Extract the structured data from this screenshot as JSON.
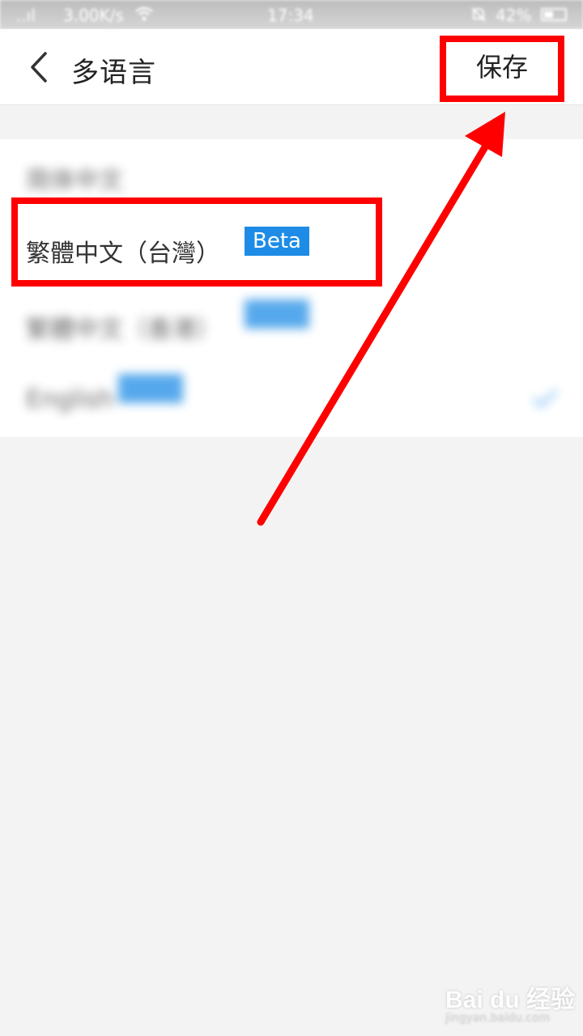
{
  "status_bar": {
    "signal": "..ıl",
    "net_speed": "3.00K/s",
    "time": "17:34",
    "battery_percent": "42%"
  },
  "nav": {
    "title": "多语言",
    "save_label": "保存"
  },
  "languages": [
    {
      "label": "简体中文",
      "badge": "",
      "blurred": true
    },
    {
      "label": "繁體中文（台灣）",
      "badge": "Beta",
      "blurred": false
    },
    {
      "label": "繁體中文（香港）",
      "badge": "",
      "blurred": true
    },
    {
      "label": "English",
      "badge": "",
      "blurred": true,
      "selected": true
    }
  ],
  "watermark": {
    "brand": "Bai du 经验",
    "url": "jingyan.baidu.com"
  },
  "colors": {
    "annotation": "#ff0000",
    "badge": "#1e8ce6",
    "check": "#1e8ce6"
  }
}
